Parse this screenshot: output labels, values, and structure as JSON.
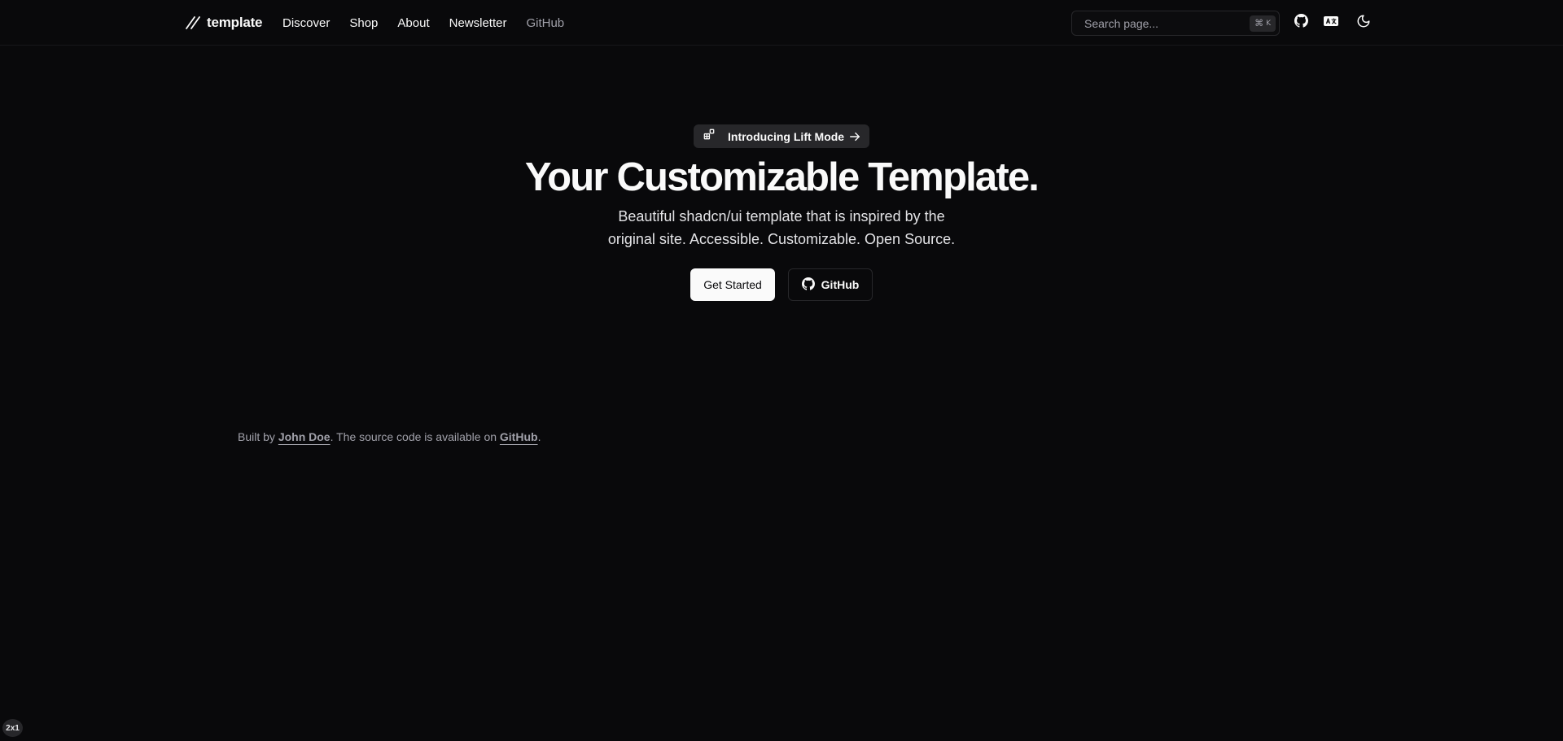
{
  "header": {
    "brand": "template",
    "nav": [
      {
        "label": "Discover"
      },
      {
        "label": "Shop"
      },
      {
        "label": "About"
      },
      {
        "label": "Newsletter"
      },
      {
        "label": "GitHub"
      }
    ],
    "search": {
      "placeholder": "Search page...",
      "shortcut_symbol": "⌘",
      "shortcut_key": "K"
    },
    "icons": [
      "github-icon",
      "language-icon",
      "moon-icon"
    ]
  },
  "hero": {
    "announcement": "Introducing Lift Mode",
    "title": "Your Customizable Template.",
    "subtitle_line1": "Beautiful shadcn/ui template that is inspired by the",
    "subtitle_line2": "original site. Accessible. Customizable. Open Source.",
    "primary_button": "Get Started",
    "secondary_button": "GitHub"
  },
  "footer": {
    "prefix": "Built by ",
    "author": "John Doe",
    "middle": ". The source code is available on ",
    "repo": "GitHub",
    "suffix": "."
  },
  "badge": "2x1",
  "colors": {
    "background": "#09090b",
    "foreground": "#fafafa",
    "muted": "#a1a1aa",
    "border": "#27272a"
  }
}
